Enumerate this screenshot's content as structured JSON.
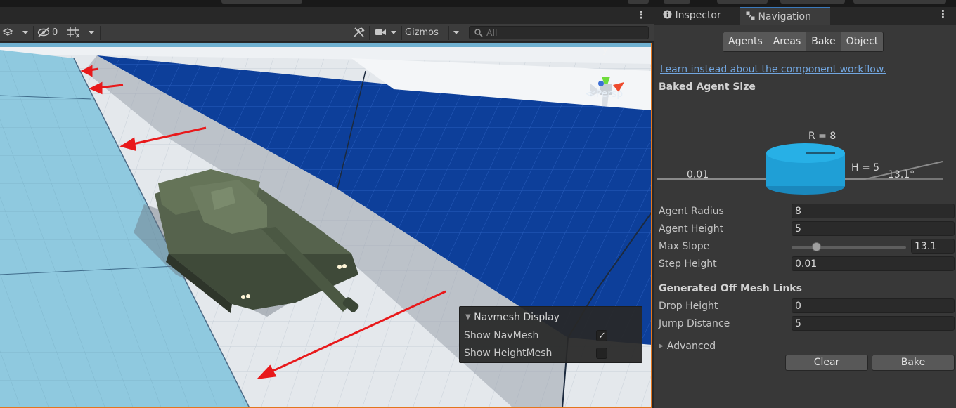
{
  "scene_toolbar": {
    "hidden_count": "0",
    "gizmos_label": "Gizmos",
    "search_placeholder": "All"
  },
  "viewport": {
    "persp_label": "Persp",
    "gizmo_axis_label": "y"
  },
  "navmesh_display": {
    "title": "Navmesh Display",
    "show_navmesh_label": "Show NavMesh",
    "show_navmesh_checked": true,
    "show_heightmesh_label": "Show HeightMesh",
    "show_heightmesh_checked": false
  },
  "tabs": {
    "inspector": "Inspector",
    "navigation": "Navigation"
  },
  "nav_tabs": [
    "Agents",
    "Areas",
    "Bake",
    "Object"
  ],
  "nav_tabs_selected": "Bake",
  "workflow_link": "Learn instead about the component workflow.",
  "baked_agent_size": {
    "title": "Baked Agent Size",
    "radius_label": "R = 8",
    "height_label": "H = 5",
    "step_label": "0.01",
    "slope_label": "13.1°"
  },
  "fields": {
    "agent_radius": {
      "label": "Agent Radius",
      "value": "8"
    },
    "agent_height": {
      "label": "Agent Height",
      "value": "5"
    },
    "max_slope": {
      "label": "Max Slope",
      "value": "13.1",
      "slider_fraction": 0.22
    },
    "step_height": {
      "label": "Step Height",
      "value": "0.01"
    }
  },
  "off_mesh_links": {
    "title": "Generated Off Mesh Links",
    "drop_height": {
      "label": "Drop Height",
      "value": "0"
    },
    "jump_distance": {
      "label": "Jump Distance",
      "value": "5"
    }
  },
  "advanced_label": "Advanced",
  "buttons": {
    "clear": "Clear",
    "bake": "Bake"
  },
  "colors": {
    "accent_blue": "#3a79bb",
    "link_blue": "#72a6df",
    "navmesh_blue": "#0d3f9a",
    "viewport_border": "#e3761d",
    "annotation_arrow": "#e8191b",
    "cylinder": "#1f9fd6"
  }
}
